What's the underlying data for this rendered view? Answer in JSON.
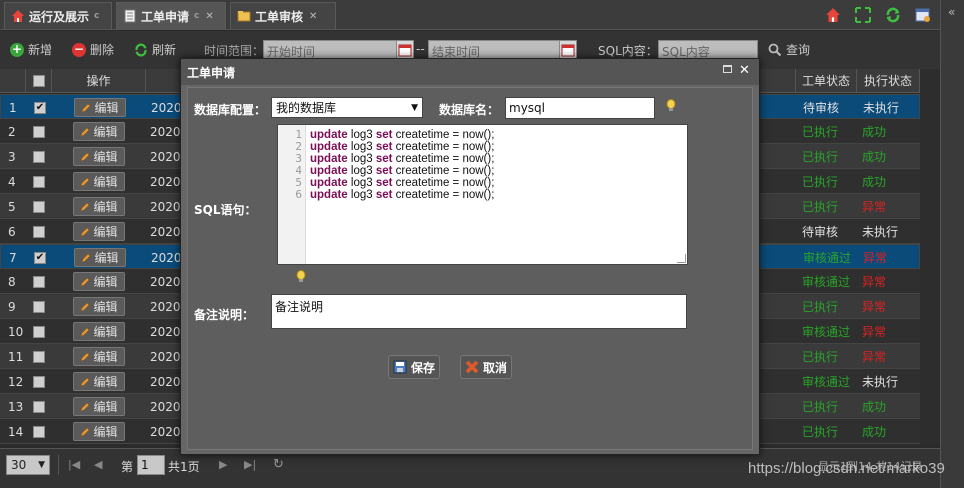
{
  "tabs": [
    {
      "label": "运行及展示",
      "icon": "home-icon",
      "active": false
    },
    {
      "label": "工单申请",
      "icon": "document-icon",
      "active": true
    },
    {
      "label": "工单审核",
      "icon": "folder-icon",
      "active": false
    }
  ],
  "toolbar": {
    "add_label": "新增",
    "delete_label": "删除",
    "refresh_label": "刷新",
    "time_range_label": "时间范围：",
    "start_placeholder": "开始时间",
    "range_sep": "--",
    "end_placeholder": "结束时间",
    "sql_label": "SQL内容：",
    "sql_placeholder": "SQL内容",
    "search_label": "查询"
  },
  "grid": {
    "headers": {
      "op": "操作",
      "ticket_status": "工单状态",
      "exec_status": "执行状态"
    },
    "edit_label": "编辑",
    "rows": [
      {
        "num": "1",
        "checked": true,
        "date": "2020",
        "ticket": "待审核",
        "exec": "未执行",
        "ticket_class": "st-wait",
        "exec_class": "st-wait",
        "style": "sel"
      },
      {
        "num": "2",
        "checked": false,
        "date": "2020",
        "ticket": "已执行",
        "exec": "成功",
        "ticket_class": "st-ok",
        "exec_class": "st-ok",
        "style": "odd"
      },
      {
        "num": "3",
        "checked": false,
        "date": "2020",
        "ticket": "已执行",
        "exec": "成功",
        "ticket_class": "st-ok",
        "exec_class": "st-ok",
        "style": "even"
      },
      {
        "num": "4",
        "checked": false,
        "date": "2020",
        "ticket": "已执行",
        "exec": "成功",
        "ticket_class": "st-ok",
        "exec_class": "st-ok",
        "style": "odd"
      },
      {
        "num": "5",
        "checked": false,
        "date": "2020",
        "ticket": "已执行",
        "exec": "异常",
        "ticket_class": "st-ok",
        "exec_class": "st-err",
        "style": "even"
      },
      {
        "num": "6",
        "checked": false,
        "date": "2020",
        "ticket": "待审核",
        "exec": "未执行",
        "ticket_class": "st-wait",
        "exec_class": "st-wait",
        "style": "odd"
      },
      {
        "num": "7",
        "checked": true,
        "date": "2020",
        "ticket": "审核通过",
        "exec": "异常",
        "ticket_class": "st-ok",
        "exec_class": "st-err",
        "style": "sel"
      },
      {
        "num": "8",
        "checked": false,
        "date": "2020",
        "ticket": "审核通过",
        "exec": "异常",
        "ticket_class": "st-ok",
        "exec_class": "st-err",
        "style": "odd"
      },
      {
        "num": "9",
        "checked": false,
        "date": "2020",
        "ticket": "已执行",
        "exec": "异常",
        "ticket_class": "st-ok",
        "exec_class": "st-err",
        "style": "even"
      },
      {
        "num": "10",
        "checked": false,
        "date": "2020",
        "ticket": "审核通过",
        "exec": "异常",
        "ticket_class": "st-ok",
        "exec_class": "st-err",
        "style": "odd"
      },
      {
        "num": "11",
        "checked": false,
        "date": "2020",
        "ticket": "已执行",
        "exec": "异常",
        "ticket_class": "st-ok",
        "exec_class": "st-err",
        "style": "even"
      },
      {
        "num": "12",
        "checked": false,
        "date": "2020",
        "ticket": "审核通过",
        "exec": "未执行",
        "ticket_class": "st-ok",
        "exec_class": "st-wait",
        "style": "odd"
      },
      {
        "num": "13",
        "checked": false,
        "date": "2020",
        "ticket": "已执行",
        "exec": "成功",
        "ticket_class": "st-ok",
        "exec_class": "st-ok",
        "style": "even"
      },
      {
        "num": "14",
        "checked": false,
        "date": "2020",
        "ticket": "已执行",
        "exec": "成功",
        "ticket_class": "st-ok",
        "exec_class": "st-ok",
        "style": "odd"
      }
    ]
  },
  "pager": {
    "page_size": "30",
    "page_label_pre": "第",
    "page_value": "1",
    "page_label_post": "共1页",
    "summary": "显示1到14,共14记录"
  },
  "dialog": {
    "title": "工单申请",
    "db_config_label": "数据库配置：",
    "db_config_value": "我的数据库",
    "db_name_label": "数据库名：",
    "db_name_value": "mysql",
    "sql_label": "SQL语句：",
    "line_numbers": [
      "1",
      "2",
      "3",
      "4",
      "5",
      "6"
    ],
    "code_lines": [
      {
        "kw1": "update",
        "tbl": " log3 ",
        "kw2": "set",
        "rest": " createtime = now();"
      },
      {
        "kw1": "update",
        "tbl": " log3 ",
        "kw2": "set",
        "rest": " createtime = now();"
      },
      {
        "kw1": "update",
        "tbl": " log3 ",
        "kw2": "set",
        "rest": " createtime = now();"
      },
      {
        "kw1": "update",
        "tbl": " log3 ",
        "kw2": "set",
        "rest": " createtime = now();"
      },
      {
        "kw1": "update",
        "tbl": " log3 ",
        "kw2": "set",
        "rest": " createtime = now();"
      },
      {
        "kw1": "update",
        "tbl": " log3 ",
        "kw2": "set",
        "rest": " createtime = now();"
      }
    ],
    "remark_label": "备注说明：",
    "remark_value": "备注说明",
    "save_label": "保存",
    "cancel_label": "取消"
  },
  "watermark": "https://blog.csdn.net/marko39",
  "colors": {
    "accent_blue": "#0b4b7a",
    "ok_green": "#28a428",
    "err_red": "#dd2222",
    "keyword": "#7a0f57"
  }
}
